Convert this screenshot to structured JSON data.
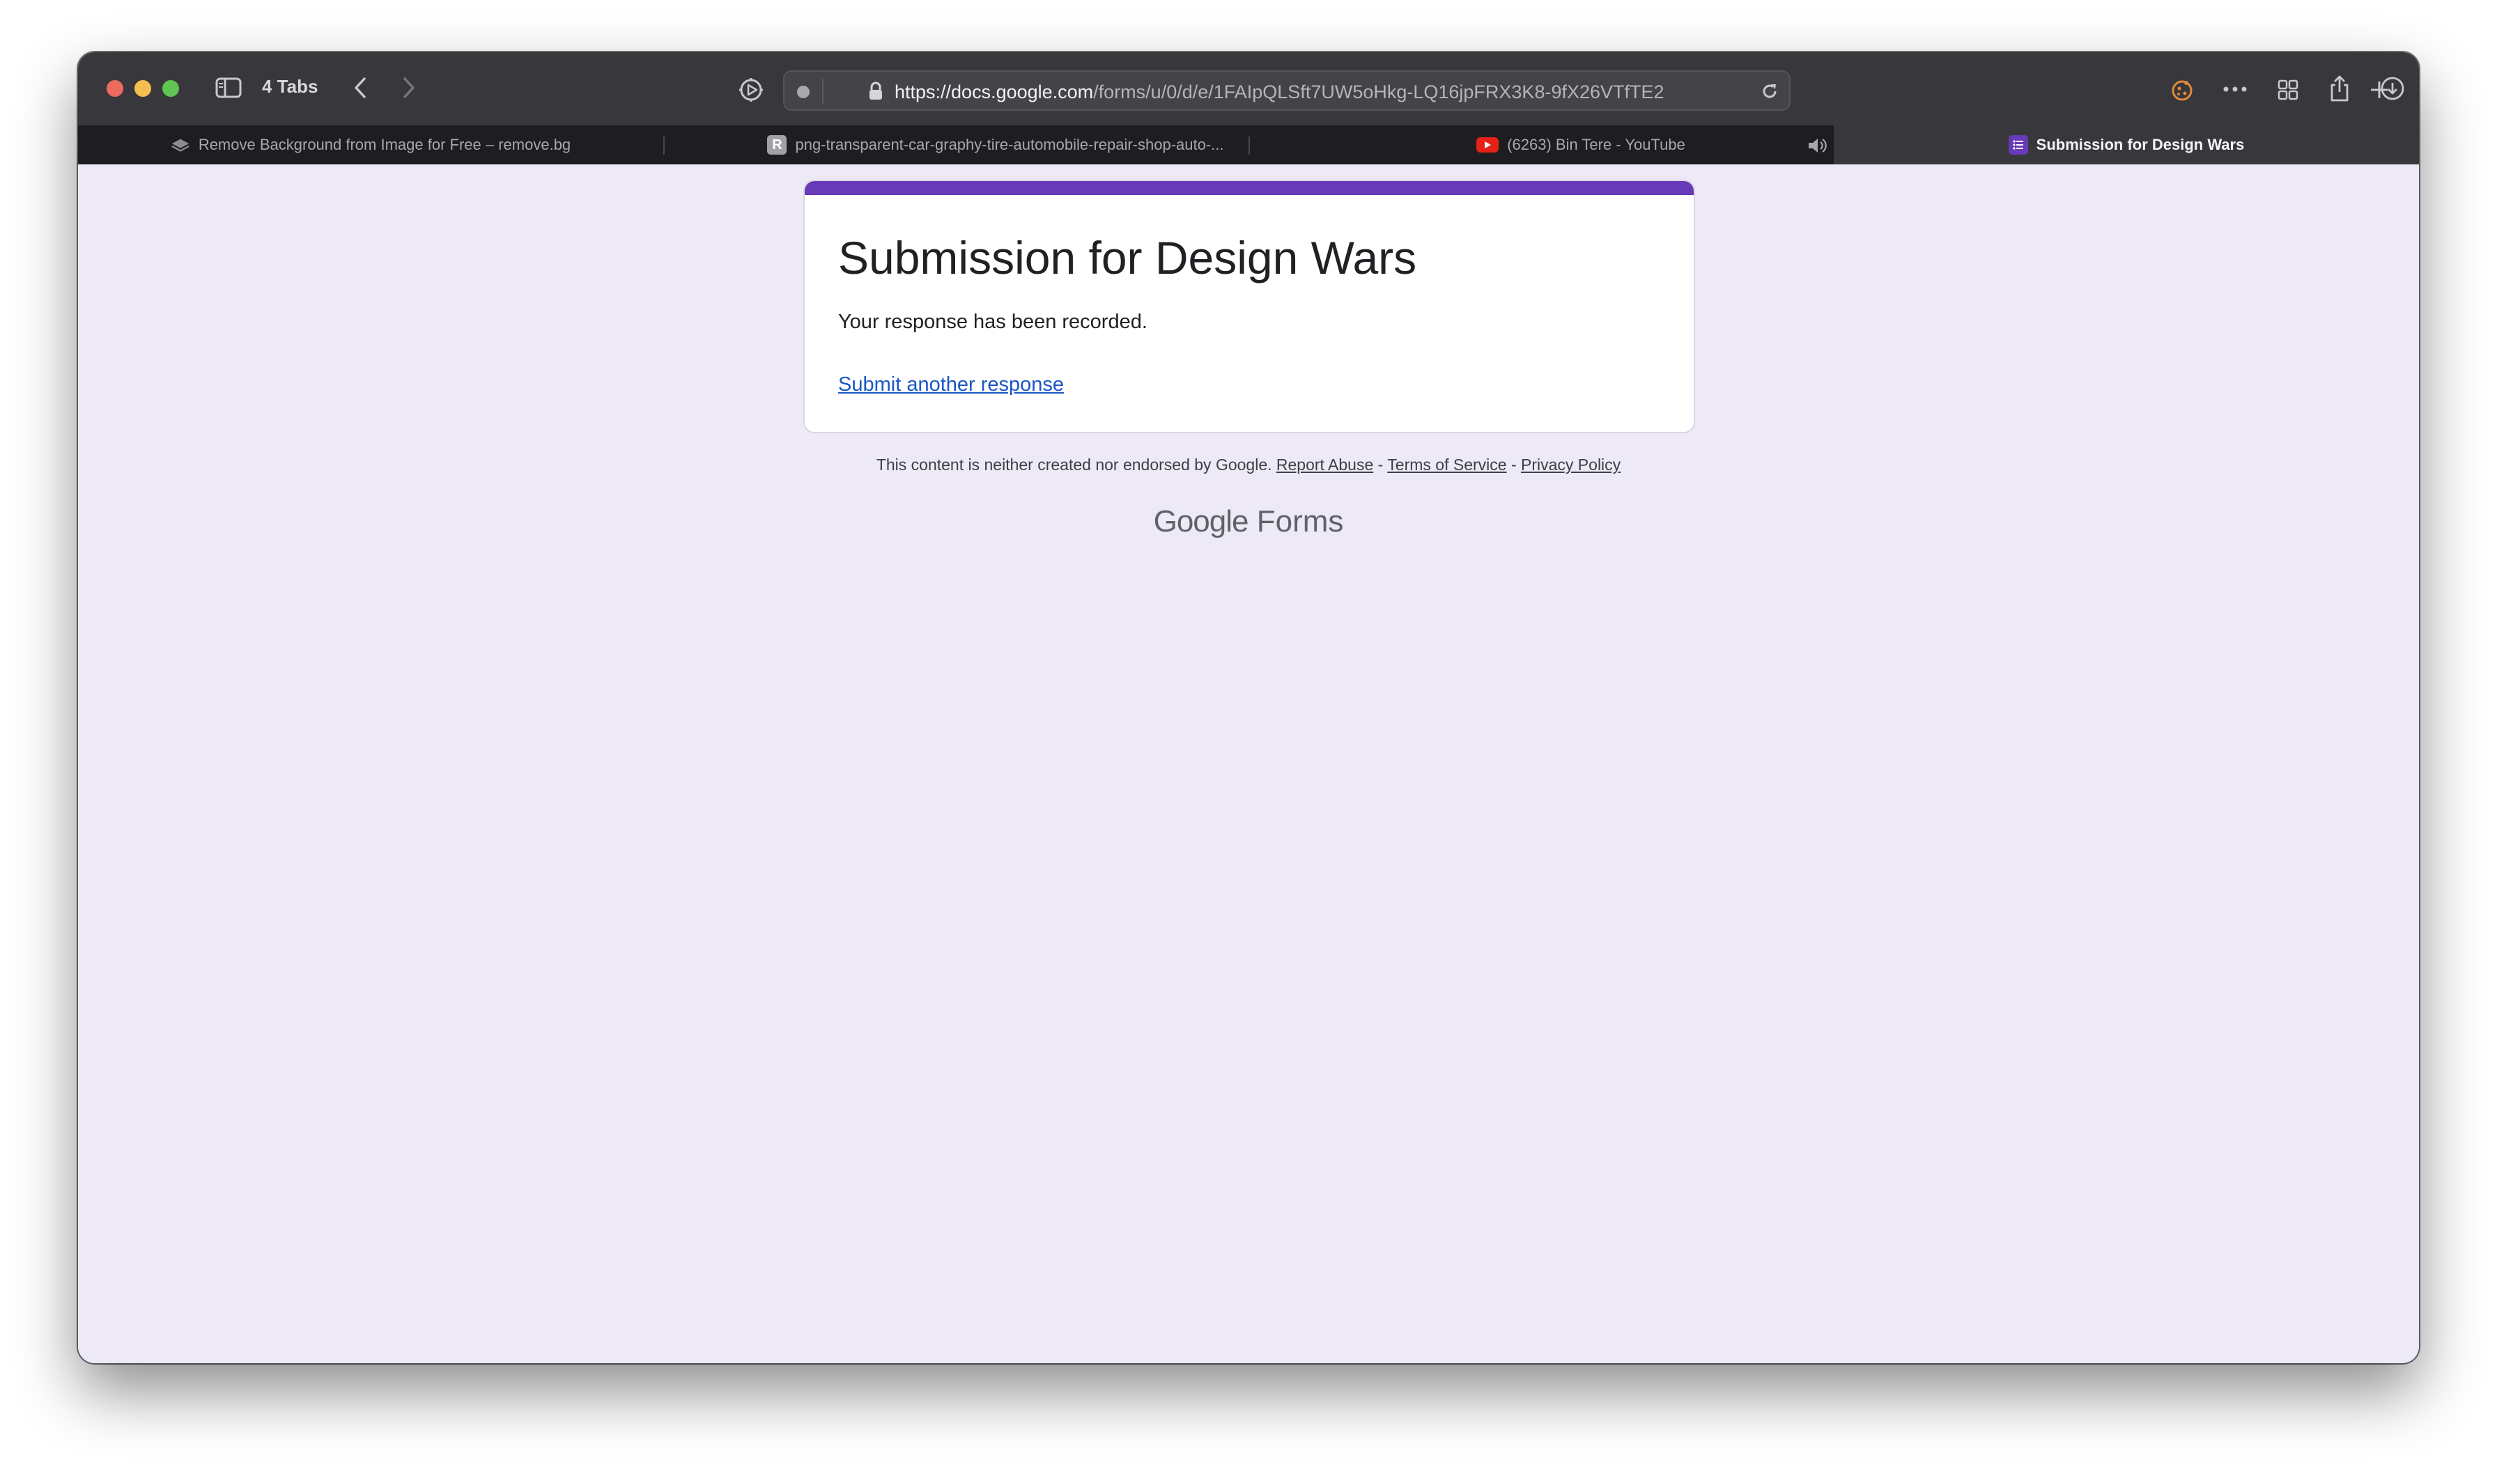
{
  "browser": {
    "tabs_count_label": "4 Tabs",
    "url_host": "https://docs.google.com",
    "url_path": "/forms/u/0/d/e/1FAIpQLSft7UW5oHkg-LQ16jpFRX3K8-9fX26VTfTE2",
    "tabs": [
      {
        "label": "Remove Background from Image for Free – remove.bg",
        "favicon": "layers-icon",
        "active": false
      },
      {
        "label": "png-transparent-car-graphy-tire-automobile-repair-shop-auto-...",
        "favicon": "r-letter-icon",
        "favicon_letter": "R",
        "active": false
      },
      {
        "label": "(6263) Bin Tere - YouTube",
        "favicon": "youtube-icon",
        "active": false,
        "audio": true
      },
      {
        "label": "Submission for Design Wars",
        "favicon": "forms-icon",
        "active": true
      }
    ]
  },
  "form": {
    "title": "Submission for Design Wars",
    "message": "Your response has been recorded.",
    "link": "Submit another response",
    "accent_color": "#673ab7"
  },
  "footer": {
    "disclaimer": "This content is neither created nor endorsed by Google.",
    "report_abuse": "Report Abuse",
    "sep1": " - ",
    "terms": "Terms of Service",
    "sep2": " - ",
    "privacy": "Privacy Policy",
    "brand_google": "Google",
    "brand_forms": " Forms"
  }
}
